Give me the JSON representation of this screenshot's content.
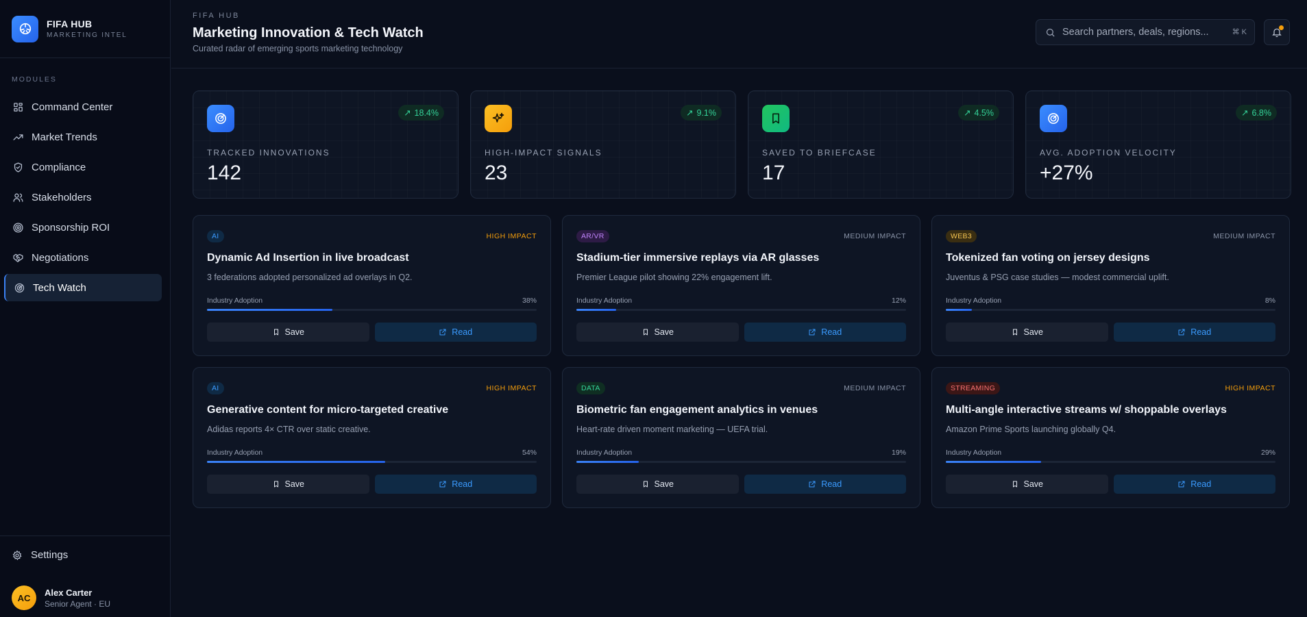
{
  "brand": {
    "title": "FIFA HUB",
    "subtitle": "MARKETING INTEL"
  },
  "sidebar": {
    "section_label": "MODULES",
    "items": [
      {
        "label": "Command Center",
        "icon": "grid-icon",
        "active": false
      },
      {
        "label": "Market Trends",
        "icon": "trending-up-icon",
        "active": false
      },
      {
        "label": "Compliance",
        "icon": "shield-check-icon",
        "active": false
      },
      {
        "label": "Stakeholders",
        "icon": "users-icon",
        "active": false
      },
      {
        "label": "Sponsorship ROI",
        "icon": "target-icon",
        "active": false
      },
      {
        "label": "Negotiations",
        "icon": "handshake-icon",
        "active": false
      },
      {
        "label": "Tech Watch",
        "icon": "radar-icon",
        "active": true
      }
    ],
    "settings_label": "Settings"
  },
  "user": {
    "initials": "AC",
    "name": "Alex Carter",
    "role": "Senior Agent · EU"
  },
  "header": {
    "eyebrow": "FIFA HUB",
    "title": "Marketing Innovation & Tech Watch",
    "subtitle": "Curated radar of emerging sports marketing technology",
    "search_placeholder": "Search partners, deals, regions...",
    "search_shortcut": "⌘ K"
  },
  "stats": [
    {
      "label": "TRACKED INNOVATIONS",
      "value": "142",
      "delta": "18.4%",
      "icon": "radar-icon",
      "color": "#2f7cf6"
    },
    {
      "label": "HIGH-IMPACT SIGNALS",
      "value": "23",
      "delta": "9.1%",
      "icon": "sparkles-icon",
      "color": "#f59e0b"
    },
    {
      "label": "SAVED TO BRIEFCASE",
      "value": "17",
      "delta": "4.5%",
      "icon": "bookmark-icon",
      "color": "#10b981"
    },
    {
      "label": "AVG. ADOPTION VELOCITY",
      "value": "+27%",
      "delta": "6.8%",
      "icon": "radar-icon",
      "color": "#2f7cf6"
    }
  ],
  "cards": [
    {
      "tag": "AI",
      "impact": "HIGH IMPACT",
      "title": "Dynamic Ad Insertion in live broadcast",
      "desc": "3 federations adopted personalized ad overlays in Q2.",
      "adoption_label": "Industry Adoption",
      "adoption_pct": "38%",
      "save_label": "Save",
      "read_label": "Read"
    },
    {
      "tag": "AR/VR",
      "impact": "MEDIUM IMPACT",
      "title": "Stadium-tier immersive replays via AR glasses",
      "desc": "Premier League pilot showing 22% engagement lift.",
      "adoption_label": "Industry Adoption",
      "adoption_pct": "12%",
      "save_label": "Save",
      "read_label": "Read"
    },
    {
      "tag": "WEB3",
      "impact": "MEDIUM IMPACT",
      "title": "Tokenized fan voting on jersey designs",
      "desc": "Juventus & PSG case studies — modest commercial uplift.",
      "adoption_label": "Industry Adoption",
      "adoption_pct": "8%",
      "save_label": "Save",
      "read_label": "Read"
    },
    {
      "tag": "AI",
      "impact": "HIGH IMPACT",
      "title": "Generative content for micro-targeted creative",
      "desc": "Adidas reports 4× CTR over static creative.",
      "adoption_label": "Industry Adoption",
      "adoption_pct": "54%",
      "save_label": "Save",
      "read_label": "Read"
    },
    {
      "tag": "DATA",
      "impact": "MEDIUM IMPACT",
      "title": "Biometric fan engagement analytics in venues",
      "desc": "Heart-rate driven moment marketing — UEFA trial.",
      "adoption_label": "Industry Adoption",
      "adoption_pct": "19%",
      "save_label": "Save",
      "read_label": "Read"
    },
    {
      "tag": "STREAMING",
      "impact": "HIGH IMPACT",
      "title": "Multi-angle interactive streams w/ shoppable overlays",
      "desc": "Amazon Prime Sports launching globally Q4.",
      "adoption_label": "Industry Adoption",
      "adoption_pct": "29%",
      "save_label": "Save",
      "read_label": "Read"
    }
  ],
  "colors": {
    "accent": "#3b82f6",
    "high_impact": "#f59e0b",
    "medium_impact": "#8a94a8",
    "positive": "#34d399",
    "tag_ai": "#3b9bff",
    "tag_arvr": "#c084fc",
    "tag_web3": "#f5c451",
    "tag_data": "#34d399",
    "tag_streaming": "#f87171"
  }
}
